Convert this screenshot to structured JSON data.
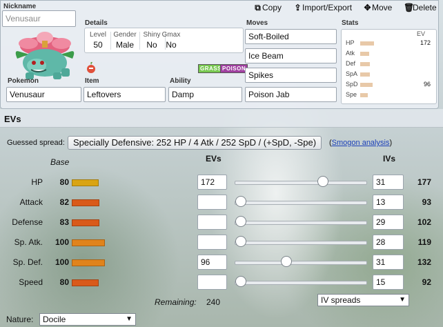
{
  "nickname": {
    "label": "Nickname",
    "placeholder": "Venusaur"
  },
  "toolbar": {
    "copy": "Copy",
    "import_export": "Import/Export",
    "move": "Move",
    "delete": "Delete"
  },
  "details": {
    "label": "Details",
    "level": {
      "label": "Level",
      "value": "50"
    },
    "gender": {
      "label": "Gender",
      "value": "Male"
    },
    "shiny": {
      "label": "Shiny",
      "value": "No"
    },
    "gmax": {
      "label": "Gmax",
      "value": "No"
    }
  },
  "types": [
    "GRASS",
    "POISON"
  ],
  "type_colors": {
    "GRASS": "#78c850",
    "POISON": "#a040a0"
  },
  "pokemon": {
    "label": "Pokemon",
    "value": "Venusaur"
  },
  "item": {
    "label": "Item",
    "value": "Leftovers"
  },
  "ability": {
    "label": "Ability",
    "value": "Damp"
  },
  "moves": {
    "label": "Moves",
    "list": [
      "Soft-Boiled",
      "Ice Beam",
      "Spikes",
      "Poison Jab"
    ]
  },
  "stats_summary": {
    "label": "Stats",
    "ev_header": "EV",
    "rows": [
      {
        "name": "HP",
        "ev": "172",
        "fill": 0.55
      },
      {
        "name": "Atk",
        "ev": "",
        "fill": 0.35
      },
      {
        "name": "Def",
        "ev": "",
        "fill": 0.38
      },
      {
        "name": "SpA",
        "ev": "",
        "fill": 0.4
      },
      {
        "name": "SpD",
        "ev": "96",
        "fill": 0.5
      },
      {
        "name": "Spe",
        "ev": "",
        "fill": 0.3
      }
    ]
  },
  "ev_section": {
    "title": "EVs",
    "guessed_label": "Guessed spread:",
    "guessed_value": "Specially Defensive: 252 HP / 4 Atk / 252 SpD / (+SpD, -Spe)",
    "smogon_open": "(",
    "smogon_link": "Smogon analysis",
    "smogon_close": ")",
    "col_base": "Base",
    "col_evs": "EVs",
    "col_ivs": "IVs",
    "stats": [
      {
        "name": "HP",
        "base": "80",
        "ev": "172",
        "iv": "31",
        "total": "177",
        "base_value": 80,
        "ev_value": 172
      },
      {
        "name": "Attack",
        "base": "82",
        "ev": "",
        "iv": "13",
        "total": "93",
        "base_value": 82,
        "ev_value": 0
      },
      {
        "name": "Defense",
        "base": "83",
        "ev": "",
        "iv": "29",
        "total": "102",
        "base_value": 83,
        "ev_value": 0
      },
      {
        "name": "Sp. Atk.",
        "base": "100",
        "ev": "",
        "iv": "28",
        "total": "119",
        "base_value": 100,
        "ev_value": 0
      },
      {
        "name": "Sp. Def.",
        "base": "100",
        "ev": "96",
        "iv": "31",
        "total": "132",
        "base_value": 100,
        "ev_value": 96
      },
      {
        "name": "Speed",
        "base": "80",
        "ev": "",
        "iv": "15",
        "total": "92",
        "base_value": 80,
        "ev_value": 0
      }
    ],
    "ev_max": 252,
    "remaining_label": "Remaining:",
    "remaining_value": "240",
    "iv_spreads": "IV spreads",
    "nature_label": "Nature:",
    "nature_value": "Docile"
  }
}
